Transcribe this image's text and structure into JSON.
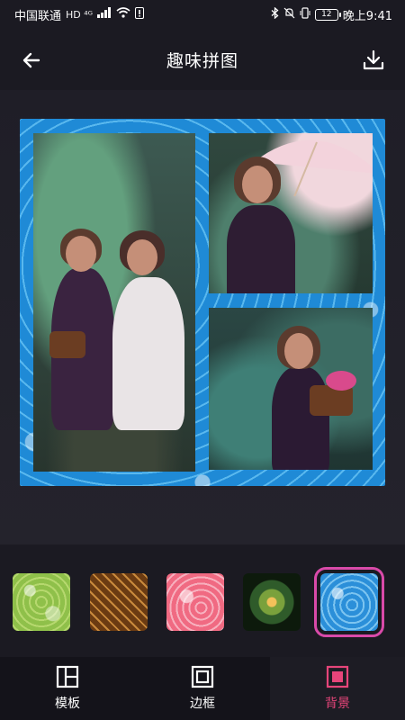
{
  "status_bar": {
    "carrier": "中国联通",
    "network_badges": "HD ⁴ᴳ",
    "battery": "12",
    "time": "晚上9:41"
  },
  "toolbar": {
    "title": "趣味拼图",
    "back_icon": "back-arrow-icon",
    "download_icon": "download-icon"
  },
  "collage": {
    "frame_color": "#1f8ad6",
    "photos": [
      {
        "name": "photo-left",
        "description_icon": "photo"
      },
      {
        "name": "photo-top-right",
        "description_icon": "photo"
      },
      {
        "name": "photo-bottom-right",
        "description_icon": "photo"
      }
    ]
  },
  "backgrounds": {
    "selected_index": 4,
    "items": [
      {
        "color": "#8fc04a"
      },
      {
        "color": "#6b3b12"
      },
      {
        "color": "#f06a82"
      },
      {
        "color": "#2f5b2a"
      },
      {
        "color": "#2b8fd9"
      }
    ],
    "selection_color": "#d94aa9"
  },
  "tabs": [
    {
      "label": "模板",
      "icon": "template-icon",
      "active": false
    },
    {
      "label": "边框",
      "icon": "frame-icon",
      "active": false
    },
    {
      "label": "背景",
      "icon": "background-icon",
      "active": true
    }
  ],
  "colors": {
    "accent": "#e6457a",
    "background": "#14131a"
  }
}
